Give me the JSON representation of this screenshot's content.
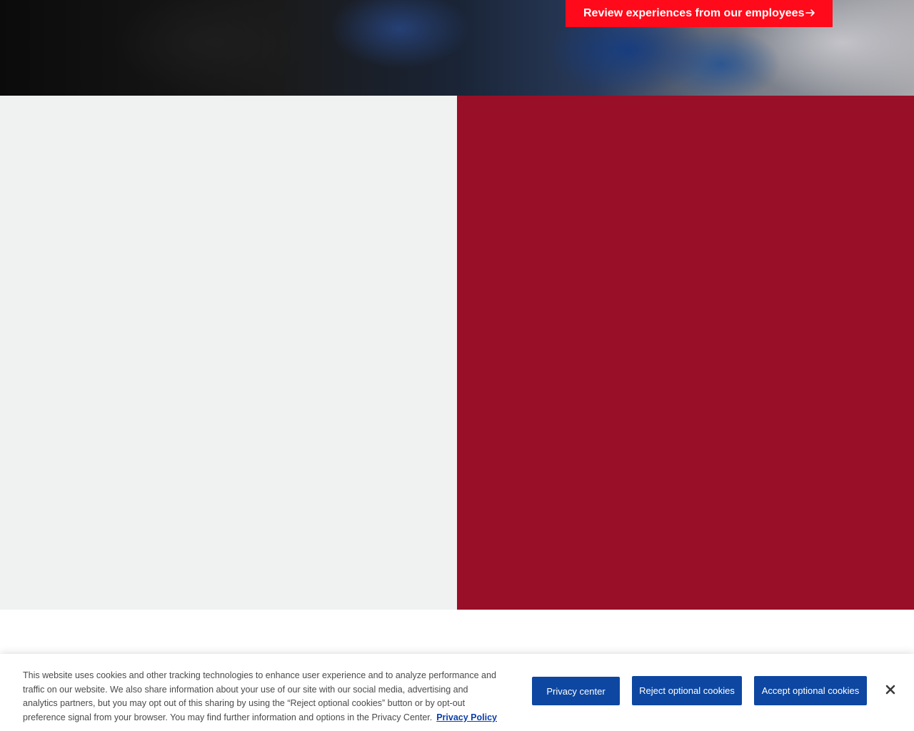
{
  "hero": {
    "cta_label": "Review experiences from our employees",
    "cta_icon": "arrow-right-icon",
    "cta_color": "#ff0a1a"
  },
  "panels": {
    "left_color": "#f0f2f1",
    "right_color": "#990f28"
  },
  "cookie_banner": {
    "text": "This website uses cookies and other tracking technologies to enhance user experience and to analyze performance and traffic on our website. We also share information about your use of our site with our social media, advertising and analytics partners, but you may opt out of this sharing by using the “Reject optional cookies” button or by opt-out preference signal from your browser. You may find further information and options in the Privacy Center.",
    "privacy_policy_link": "Privacy Policy",
    "privacy_center_button": "Privacy center",
    "reject_button": "Reject optional cookies",
    "accept_button": "Accept optional cookies",
    "close_icon": "close-icon",
    "button_color": "#0d47a1"
  }
}
